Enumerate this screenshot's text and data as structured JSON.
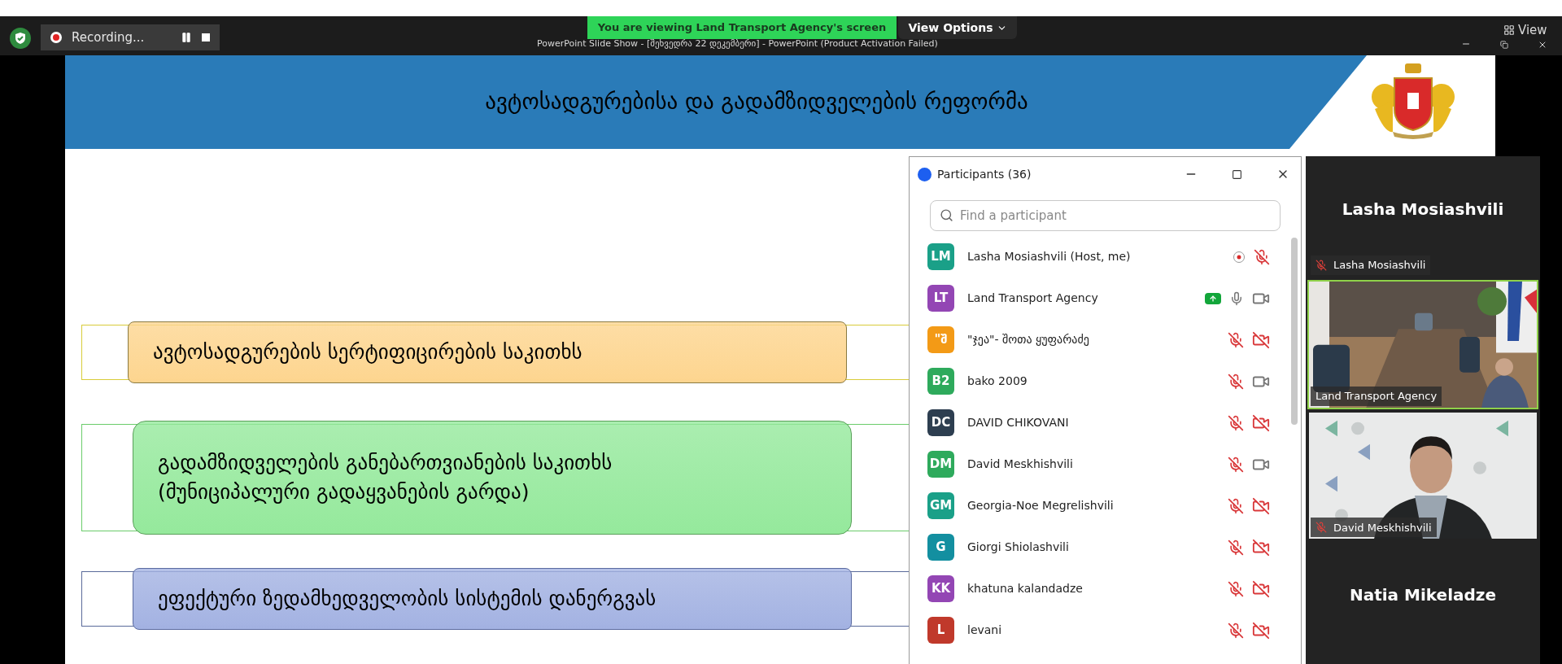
{
  "top_bar": {
    "recording": {
      "label": "Recording...",
      "paused": false
    },
    "sharing_banner": "You are viewing Land Transport Agency's screen",
    "view_options": "View Options",
    "view": "View"
  },
  "window": {
    "title": "PowerPoint Slide Show - [შეხვედრა 22 დეკემბერი] - PowerPoint (Product Activation Failed)"
  },
  "slide": {
    "title": "ავტოსადგურებისა და გადამზიდველების რეფორმა",
    "items": [
      {
        "text": "ავტოსადგურების სერტიფიცირების საკითხს",
        "color": "#fdd58f"
      },
      {
        "text": "გადამზიდველების განებართვიანების საკითხს\n(მუნიციპალური გადაყვანების გარდა)",
        "color": "#95e99c"
      },
      {
        "text": "ეფექტური ზედამხედველობის სისტემის დანერგვას",
        "color": "#a3b2e2"
      }
    ]
  },
  "participants_window": {
    "title": "Participants (36)",
    "search": {
      "placeholder": "Find a participant"
    },
    "participants": [
      {
        "initials": "LM",
        "name": "Lasha Mosiashvili (Host, me)",
        "color": "#1aa088",
        "recording": true,
        "sharing": false,
        "muted": true
      },
      {
        "initials": "LT",
        "name": "Land Transport Agency",
        "color": "#9346b4",
        "recording": false,
        "sharing": true,
        "muted": false,
        "video_off": false
      },
      {
        "initials": "\"შ",
        "name": "\"ჯეა\"- შოთა ყუფარაძე",
        "color": "#f39a16",
        "recording": false,
        "sharing": false,
        "muted": true,
        "video_off": true
      },
      {
        "initials": "B2",
        "name": "bako 2009",
        "color": "#2eaa5c",
        "recording": false,
        "sharing": false,
        "muted": true,
        "video_off": false
      },
      {
        "initials": "DC",
        "name": "DAVID CHIKOVANI",
        "color": "#2d3e50",
        "recording": false,
        "sharing": false,
        "muted": true,
        "video_off": true
      },
      {
        "initials": "DM",
        "name": "David Meskhishvili",
        "color": "#2eaa5c",
        "recording": false,
        "sharing": false,
        "muted": true,
        "video_off": false
      },
      {
        "initials": "GM",
        "name": "Georgia-Noe Megrelishvili",
        "color": "#1aa088",
        "recording": false,
        "sharing": false,
        "muted": true,
        "video_off": true
      },
      {
        "initials": "G",
        "name": "Giorgi Shiolashvili",
        "color": "#138fa0",
        "recording": false,
        "sharing": false,
        "muted": true,
        "video_off": true
      },
      {
        "initials": "KK",
        "name": "khatuna kalandadze",
        "color": "#9346b4",
        "recording": false,
        "sharing": false,
        "muted": true,
        "video_off": true
      },
      {
        "initials": "L",
        "name": "levani",
        "color": "#c0392b",
        "recording": false,
        "sharing": false,
        "muted": true,
        "video_off": true
      }
    ]
  },
  "video_tiles": [
    {
      "kind": "name_only",
      "name": "Lasha Mosiashvili",
      "caption": "Lasha Mosiashvili",
      "muted": true,
      "speaking": false
    },
    {
      "kind": "room",
      "caption": "Land Transport Agency",
      "muted": false,
      "speaking": true
    },
    {
      "kind": "person",
      "caption": "David Meskhishvili",
      "muted": true,
      "speaking": false
    },
    {
      "kind": "name_only",
      "name": "Natia Mikeladze",
      "speaking": false
    }
  ]
}
